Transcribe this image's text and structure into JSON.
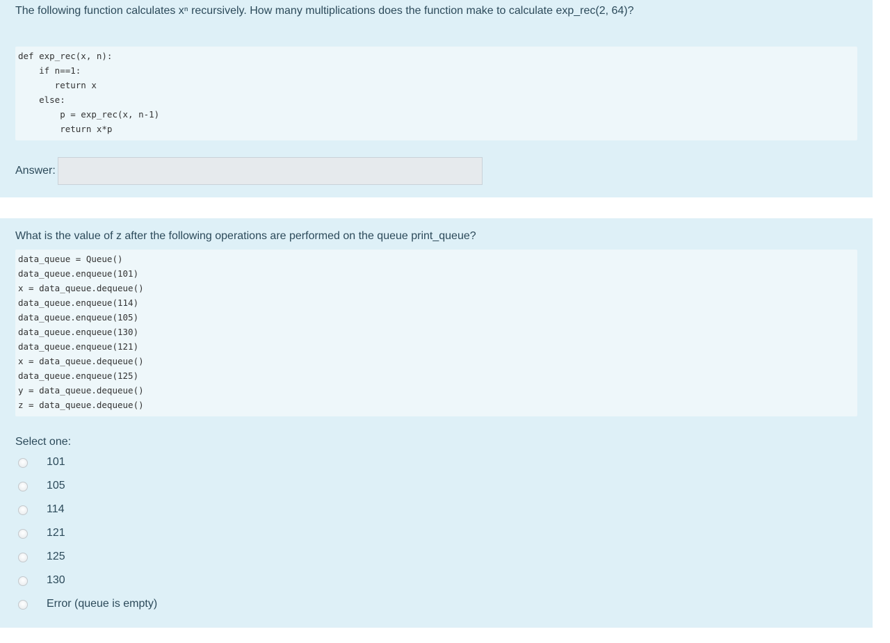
{
  "question1": {
    "text": "The following function calculates xⁿ recursively. How many multiplications does the function make to calculate exp_rec(2, 64)?",
    "code": [
      "def exp_rec(x, n):",
      "    if n==1:",
      "       return x",
      "    else:",
      "        p = exp_rec(x, n-1)",
      "        return x*p"
    ],
    "answer_label": "Answer:",
    "answer_value": ""
  },
  "question2": {
    "text": "What is the value of z after the following operations are performed on the queue print_queue?",
    "code": [
      "data_queue = Queue()",
      "data_queue.enqueue(101)",
      "x = data_queue.dequeue()",
      "data_queue.enqueue(114)",
      "data_queue.enqueue(105)",
      "data_queue.enqueue(130)",
      "data_queue.enqueue(121)",
      "x = data_queue.dequeue()",
      "data_queue.enqueue(125)",
      "y = data_queue.dequeue()",
      "z = data_queue.dequeue()"
    ],
    "select_label": "Select one:",
    "options": [
      "101",
      "105",
      "114",
      "121",
      "125",
      "130",
      "Error (queue is empty)"
    ]
  },
  "colors": {
    "question_bg": "#def0f7",
    "code_bg": "#eef7fa",
    "text": "#2c4a5a",
    "input_bg": "#e6eaed"
  }
}
